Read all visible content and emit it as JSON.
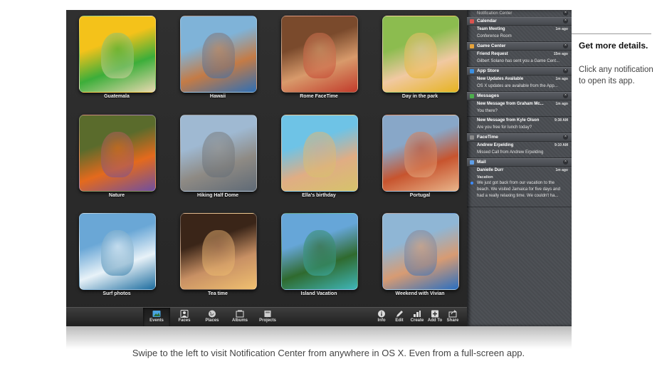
{
  "events": [
    {
      "label": "Guatemala",
      "colors": [
        "#f4c21a",
        "#3cae3a",
        "#e8d8b0"
      ]
    },
    {
      "label": "Hawaii",
      "colors": [
        "#7fb3d8",
        "#c47b46",
        "#2f6fb5"
      ]
    },
    {
      "label": "Rome FaceTime",
      "colors": [
        "#7a4a2c",
        "#d89a6b",
        "#c23b2b"
      ]
    },
    {
      "label": "Day in the park",
      "colors": [
        "#8cbc4f",
        "#f1c9a2",
        "#e6b321"
      ]
    },
    {
      "label": "Nature",
      "colors": [
        "#5a6b2c",
        "#e46a1d",
        "#6f4fa1"
      ]
    },
    {
      "label": "Hiking Half Dome",
      "colors": [
        "#9fb9d2",
        "#8e8a84",
        "#5f6a76"
      ]
    },
    {
      "label": "Ella's birthday",
      "colors": [
        "#6ec3e6",
        "#e0ad84",
        "#d6c36b"
      ]
    },
    {
      "label": "Portugal",
      "colors": [
        "#88a7c8",
        "#c7542e",
        "#e8b48a"
      ]
    },
    {
      "label": "Surf photos",
      "colors": [
        "#6aa7d6",
        "#e8f2f8",
        "#1d6d9f"
      ]
    },
    {
      "label": "Tea time",
      "colors": [
        "#3a2518",
        "#c89064",
        "#f0c070"
      ]
    },
    {
      "label": "Island Vacation",
      "colors": [
        "#66a6d8",
        "#2f6a2e",
        "#3fb6b9"
      ]
    },
    {
      "label": "Weekend with Vivian",
      "colors": [
        "#8fb6d5",
        "#d79b73",
        "#2b6fc0"
      ]
    }
  ],
  "toolbar": {
    "left": [
      {
        "label": "Events",
        "icon": "events-icon",
        "active": true
      },
      {
        "label": "Faces",
        "icon": "faces-icon",
        "active": false
      },
      {
        "label": "Places",
        "icon": "places-icon",
        "active": false
      },
      {
        "label": "Albums",
        "icon": "albums-icon",
        "active": false
      },
      {
        "label": "Projects",
        "icon": "projects-icon",
        "active": false
      }
    ],
    "right": [
      {
        "label": "Info",
        "icon": "info-icon"
      },
      {
        "label": "Edit",
        "icon": "edit-icon"
      },
      {
        "label": "Create",
        "icon": "create-icon"
      },
      {
        "label": "Add To",
        "icon": "add-to-icon"
      },
      {
        "label": "Share",
        "icon": "share-icon"
      }
    ]
  },
  "notification_center": {
    "title": "Notification Center",
    "sections": [
      {
        "app": "Calendar",
        "icon_color": "#d9534f",
        "items": [
          {
            "title": "Team Meeting",
            "time": "1m ago",
            "body": "Conference Room",
            "unread": false
          }
        ]
      },
      {
        "app": "Game Center",
        "icon_color": "#e8a33a",
        "items": [
          {
            "title": "Friend Request",
            "time": "15m ago",
            "body": "Gilbert Solano has sent you a Game Cent...",
            "unread": false
          }
        ]
      },
      {
        "app": "App Store",
        "icon_color": "#3b8fe0",
        "items": [
          {
            "title": "New Updates Available",
            "time": "1m ago",
            "body": "OS X updates are available from the App...",
            "unread": false
          }
        ]
      },
      {
        "app": "Messages",
        "icon_color": "#4cae4c",
        "items": [
          {
            "title": "New Message from Graham Mc...",
            "time": "1m ago",
            "body": "You there?",
            "unread": false
          },
          {
            "title": "New Message from Kyle Olson",
            "time": "9:38 AM",
            "body": "Are you free for lunch today?",
            "unread": false
          }
        ]
      },
      {
        "app": "FaceTime",
        "icon_color": "#8a8a8a",
        "items": [
          {
            "title": "Andrew Erpelding",
            "time": "9:10 AM",
            "body": "Missed Call from Andrew Erpelding",
            "unread": false
          }
        ]
      },
      {
        "app": "Mail",
        "icon_color": "#5f9ee6",
        "items": [
          {
            "title": "Danielle Durr",
            "time": "1m ago",
            "subtitle": "Vacation",
            "body": "We just got back from our vacation to the beach. We visited Jamaica for five days and had a really relaxing time. We couldn't ha...",
            "unread": true
          }
        ]
      }
    ]
  },
  "callout": {
    "title": "Get more details.",
    "body": "Click any notification to open its app."
  },
  "caption": "Swipe to the left to visit Notification Center from anywhere in OS X. Even from a full-screen app."
}
